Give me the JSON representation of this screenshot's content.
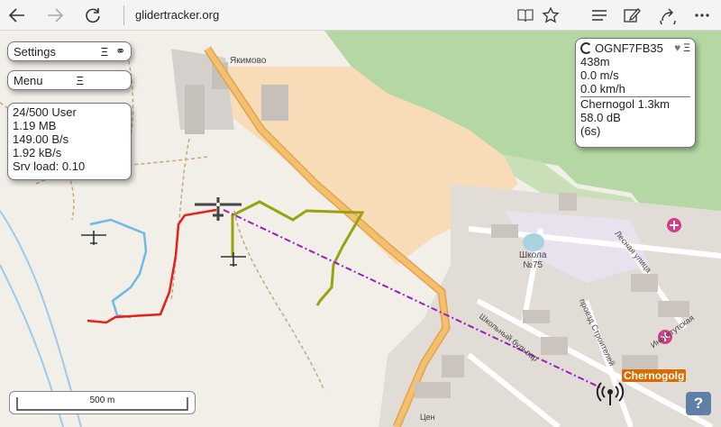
{
  "browser": {
    "url": "glidertracker.org"
  },
  "icons": {
    "back": "arrow-left",
    "forward": "arrow-right",
    "refresh": "refresh",
    "reading_view": "book",
    "favorite": "star",
    "hub": "list",
    "notes": "pen",
    "share": "share",
    "more": "more"
  },
  "controls": {
    "settings": {
      "label": "Settings",
      "glyph": "Ξ",
      "link_glyph": "⚭"
    },
    "menu": {
      "label": "Menu",
      "glyph": "Ξ"
    }
  },
  "stats": {
    "users": "24/500 User",
    "data": "1.19 MB",
    "rate_bytes": "149.00 B/s",
    "rate_kb": "1.92 kB/s",
    "srv_load": "Srv load: 0.10"
  },
  "aircraft": {
    "id": "OGNF7FB35",
    "altitude": "438m",
    "climb": "0.0 m/s",
    "speed": "0.0 km/h",
    "receiver": "Chernogol 1.3km",
    "signal": "58.0 dB",
    "age": "(6s)"
  },
  "map": {
    "village": "Якимово",
    "school": "Школа\n№75",
    "street1": "Лесная улица",
    "street2": "проезд Строителей",
    "street3": "Школьный бульвар",
    "street4": "Институтская",
    "street5": "Цен",
    "station_label": "Chernogolg",
    "scale": "500 m",
    "help": "?"
  },
  "colors": {
    "track_red": "#e8201c",
    "track_olive": "#9aa20f",
    "track_blue": "#6fb9e8",
    "link_purple": "#9b1cc3",
    "forest": "#aed39c",
    "road_orange": "#f4c06e"
  }
}
